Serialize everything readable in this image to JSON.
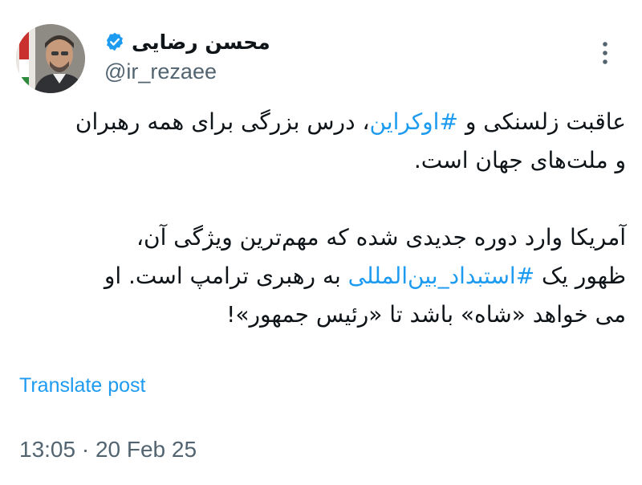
{
  "author": {
    "display_name": "محسن رضایی",
    "handle": "@ir_rezaee",
    "verified": true,
    "verified_color": "#1d9bf0",
    "avatar_icon": "profile-photo"
  },
  "more_icon": "more-vertical-icon",
  "tweet": {
    "line1_before": "عاقبت زلسنکی و ",
    "line1_hashtag": "#اوکراین",
    "line1_after": "، درس بزرگی برای همه رهبران",
    "line2": "و ملت‌های جهان است.",
    "line3": "آمریکا وارد دوره جدیدی شده که مهم‌ترین ویژگی آن،",
    "line4_before": "ظهور یک ",
    "line4_hashtag": "#استبداد_بین‌المللی",
    "line4_after": " به رهبری ترامپ است. او",
    "line5": "می خواهد «شاه» باشد تا «رئیس جمهور»!"
  },
  "translate_label": "Translate post",
  "timestamp": "13:05 · 20 Feb 25",
  "colors": {
    "link": "#1d9bf0",
    "text": "#0f1419",
    "secondary": "#536471"
  }
}
